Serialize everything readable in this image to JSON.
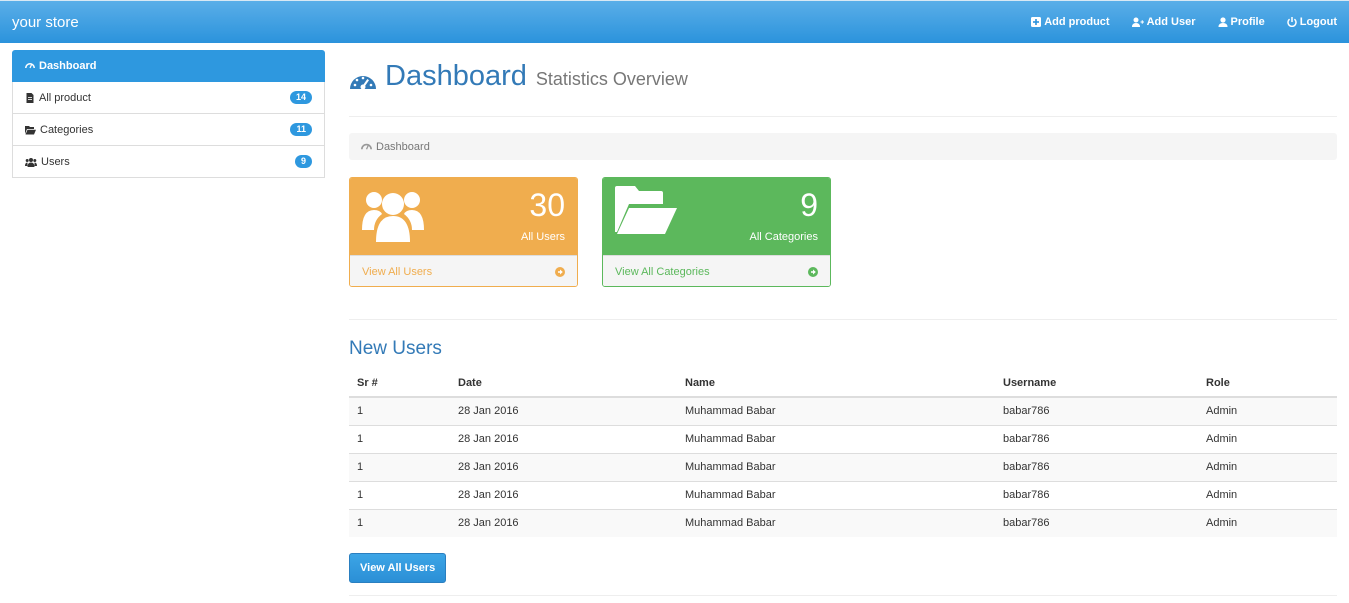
{
  "nav": {
    "brand": "your store",
    "links": [
      {
        "label": "Add product",
        "icon": "plus-square-icon"
      },
      {
        "label": "Add User",
        "icon": "user-plus-icon"
      },
      {
        "label": "Profile",
        "icon": "user-icon"
      },
      {
        "label": "Logout",
        "icon": "power-icon"
      }
    ]
  },
  "sidebar": {
    "items": [
      {
        "label": "Dashboard",
        "icon": "dashboard-icon",
        "active": true
      },
      {
        "label": "All product",
        "icon": "file-icon",
        "badge": "14"
      },
      {
        "label": "Categories",
        "icon": "folder-open-icon",
        "badge": "11"
      },
      {
        "label": "Users",
        "icon": "users-icon",
        "badge": "9"
      }
    ]
  },
  "header": {
    "title": "Dashboard",
    "subtitle": "Statistics Overview"
  },
  "breadcrumb": {
    "label": "Dashboard"
  },
  "panels": [
    {
      "count": "30",
      "label": "All Users",
      "link": "View All Users",
      "color": "#f0ad4e",
      "icon": "users-icon"
    },
    {
      "count": "9",
      "label": "All Categories",
      "link": "View All Categories",
      "color": "#5cb85c",
      "icon": "folder-open-icon"
    }
  ],
  "new_users": {
    "title": "New Users",
    "columns": [
      "Sr #",
      "Date",
      "Name",
      "Username",
      "Role"
    ],
    "rows": [
      [
        "1",
        "28 Jan 2016",
        "Muhammad Babar",
        "babar786",
        "Admin"
      ],
      [
        "1",
        "28 Jan 2016",
        "Muhammad Babar",
        "babar786",
        "Admin"
      ],
      [
        "1",
        "28 Jan 2016",
        "Muhammad Babar",
        "babar786",
        "Admin"
      ],
      [
        "1",
        "28 Jan 2016",
        "Muhammad Babar",
        "babar786",
        "Admin"
      ],
      [
        "1",
        "28 Jan 2016",
        "Muhammad Babar",
        "babar786",
        "Admin"
      ]
    ],
    "button": "View All Users"
  },
  "colors": {
    "primary": "#2e98df",
    "warning": "#f0ad4e",
    "success": "#5cb85c",
    "title": "#337ab7"
  }
}
